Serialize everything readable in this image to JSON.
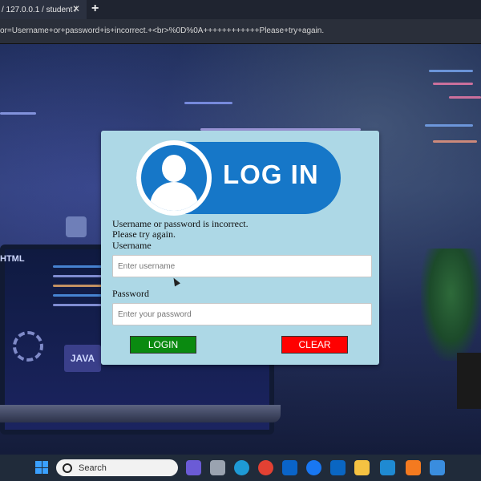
{
  "browser": {
    "tab_title": "/ 127.0.0.1 / student /",
    "tab_close": "✕",
    "new_tab": "+",
    "url": "or=Username+or+password+is+incorrect.+<br>%0D%0A++++++++++++Please+try+again."
  },
  "logo": {
    "text": "LOG IN"
  },
  "login": {
    "error_line1": "Username or password is incorrect.",
    "error_line2": "Please try again.",
    "username_label": "Username",
    "username_placeholder": "Enter username",
    "password_label": "Password",
    "password_placeholder": "Enter your password",
    "login_button": "LOGIN",
    "clear_button": "CLEAR"
  },
  "background": {
    "html_label": "HTML",
    "java_label": "JAVA"
  },
  "taskbar": {
    "search_label": "Search",
    "apps": [
      "teams-icon",
      "files-icon",
      "edge-icon",
      "chrome-icon",
      "outlook-icon",
      "facebook-icon",
      "linkedin-icon",
      "file-explorer-icon",
      "vscode-icon",
      "xampp-icon",
      "app-icon"
    ]
  },
  "colors": {
    "card_bg": "#add8e6",
    "logo_blue": "#1677c8",
    "login_green": "#0a8a10",
    "clear_red": "#ff0000"
  }
}
